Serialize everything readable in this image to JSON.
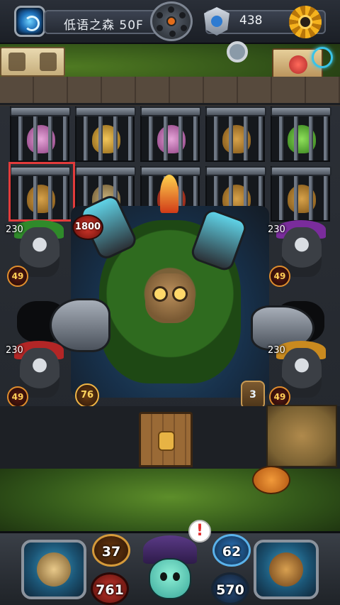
{
  "header": {
    "floor_label": "低语之森 50F",
    "gem_count": "438"
  },
  "board": {
    "boss": {
      "hp": "1800",
      "attack": "76",
      "turns": "3"
    },
    "monsters": [
      {
        "side": "left-top",
        "hp": "230",
        "attack": "49"
      },
      {
        "side": "right-top",
        "hp": "230",
        "attack": "49"
      },
      {
        "side": "left-bottom",
        "hp": "230",
        "attack": "49"
      },
      {
        "side": "right-bottom",
        "hp": "230",
        "attack": "49"
      }
    ],
    "alert_mark": "!"
  },
  "player": {
    "attack": "37",
    "hp": "761",
    "defense": "62",
    "mana": "570"
  },
  "icons": {
    "portal": "portal-icon",
    "wheel": "skill-wheel-icon",
    "gem": "gem-shield-icon",
    "settings": "gear-icon",
    "tools": "tools-sign-icon",
    "shop": "shop-sign-icon",
    "left_action": "compass-shield-icon",
    "right_action": "treasure-chest-icon"
  },
  "colors": {
    "selection": "#e23b3b",
    "hp_orb": "#c3342b",
    "defense_orb": "#2d79c0",
    "accent_gold": "#f5b21d"
  }
}
